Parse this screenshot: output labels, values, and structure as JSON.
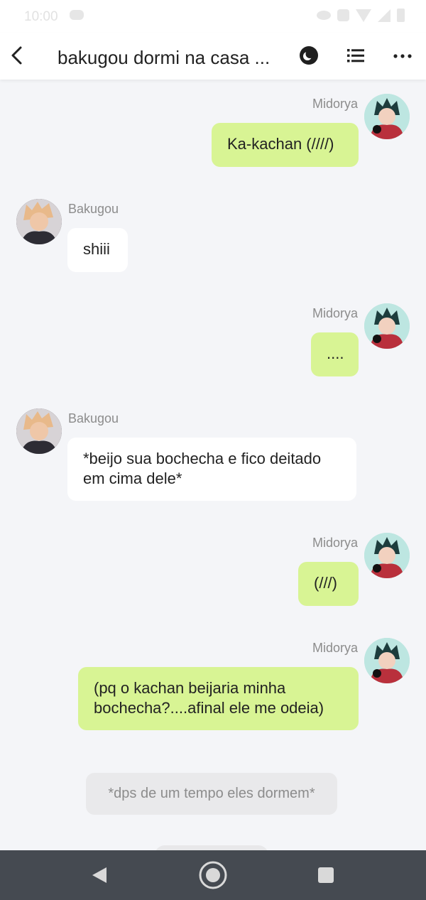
{
  "status_bar": {
    "time": "10:00"
  },
  "header": {
    "title": "bakugou dormi na casa ..."
  },
  "messages": [
    {
      "speaker": "Midorya",
      "text": "Ka-kachan (////)"
    },
    {
      "speaker": "Bakugou",
      "text": "shiii"
    },
    {
      "speaker": "Midorya",
      "text": "...."
    },
    {
      "speaker": "Bakugou",
      "text": "*beijo sua bochecha e fico deitado em cima dele*"
    },
    {
      "speaker": "Midorya",
      "text": "(///)"
    },
    {
      "speaker": "Midorya",
      "text": "(pq o kachan beijaria minha bochecha?....afinal ele me odeia)"
    }
  ],
  "narration": "*dps de um tempo eles dormem*",
  "colors": {
    "own_bubble": "#d8f494",
    "other_bubble": "#ffffff",
    "background": "#f4f5f8",
    "nav_bar": "#454a51"
  },
  "icons": {
    "back": "back-arrow-icon",
    "mode": "moon-icon",
    "list": "list-icon",
    "more": "more-dots-icon"
  }
}
